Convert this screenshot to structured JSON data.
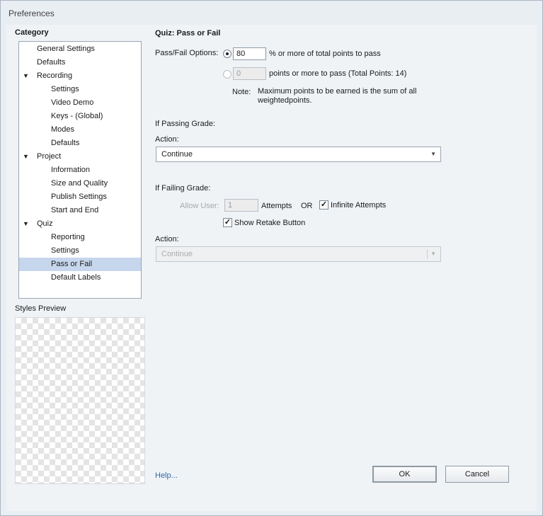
{
  "window": {
    "title": "Preferences"
  },
  "sidebar": {
    "category_label": "Category",
    "tree": [
      {
        "label": "General Settings",
        "level": 0
      },
      {
        "label": "Defaults",
        "level": 0
      },
      {
        "label": "Recording",
        "level": 0,
        "expanded": true
      },
      {
        "label": "Settings",
        "level": 1
      },
      {
        "label": "Video Demo",
        "level": 1
      },
      {
        "label": "Keys - (Global)",
        "level": 1
      },
      {
        "label": "Modes",
        "level": 1
      },
      {
        "label": "Defaults",
        "level": 1
      },
      {
        "label": "Project",
        "level": 0,
        "expanded": true
      },
      {
        "label": "Information",
        "level": 1
      },
      {
        "label": "Size and Quality",
        "level": 1
      },
      {
        "label": "Publish Settings",
        "level": 1
      },
      {
        "label": "Start and End",
        "level": 1
      },
      {
        "label": "Quiz",
        "level": 0,
        "expanded": true
      },
      {
        "label": "Reporting",
        "level": 1
      },
      {
        "label": "Settings",
        "level": 1
      },
      {
        "label": "Pass or Fail",
        "level": 1,
        "selected": true
      },
      {
        "label": "Default Labels",
        "level": 1
      }
    ],
    "styles_preview_label": "Styles Preview"
  },
  "main": {
    "heading": "Quiz: Pass or Fail",
    "pass_fail_label": "Pass/Fail Options:",
    "option_percent": {
      "value": "80",
      "suffix": "% or more of total points to pass",
      "selected": true
    },
    "option_points": {
      "value": "0",
      "suffix": "points or more to pass (Total Points: 14)",
      "selected": false
    },
    "note_label": "Note:",
    "note_line1": "Maximum points to be earned is the sum of all",
    "note_line2": "weightedpoints.",
    "passing": {
      "label": "If Passing Grade:",
      "action_label": "Action:",
      "action_value": "Continue"
    },
    "failing": {
      "label": "If Failing Grade:",
      "allow_user_label": "Allow User:",
      "attempts_value": "1",
      "attempts_label": "Attempts",
      "or_label": "OR",
      "infinite_attempts_label": "Infinite Attempts",
      "infinite_attempts_checked": true,
      "show_retake_label": "Show Retake Button",
      "show_retake_checked": true,
      "action_label": "Action:",
      "action_value": "Continue"
    }
  },
  "footer": {
    "help_link": "Help...",
    "ok_label": "OK",
    "cancel_label": "Cancel"
  },
  "icons": {
    "tree_expanded": "triangle-down-icon",
    "dropdown": "chevron-down-icon",
    "checkmark": "checkmark-icon"
  }
}
